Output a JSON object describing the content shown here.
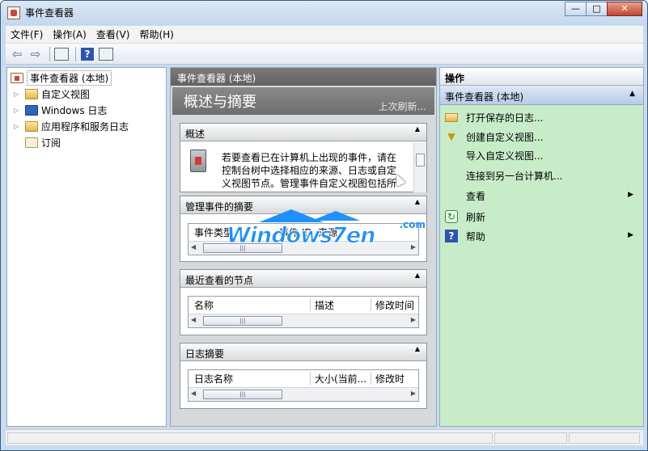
{
  "window": {
    "title": "事件查看器",
    "min": "—",
    "max": "□",
    "close": "✕"
  },
  "menu": [
    "文件(F)",
    "操作(A)",
    "查看(V)",
    "帮助(H)"
  ],
  "tree": [
    {
      "label": "事件查看器 (本地)",
      "icon": "event-viewer-icon",
      "selected": true
    },
    {
      "label": "自定义视图",
      "icon": "folder-icon"
    },
    {
      "label": "Windows 日志",
      "icon": "windows-logs-icon"
    },
    {
      "label": "应用程序和服务日志",
      "icon": "folder-icon"
    },
    {
      "label": "订阅",
      "icon": "subscriptions-icon"
    }
  ],
  "center": {
    "header": "事件查看器 (本地)",
    "banner_title": "概述与摘要",
    "banner_link": "上次刷新...",
    "overview": {
      "title": "概述",
      "text": "若要查看已在计算机上出现的事件，请在控制台树中选择相应的来源、日志或自定义视图节点。管理事件自定义视图包括所"
    },
    "admin_events": {
      "title": "管理事件的摘要",
      "cols": [
        "事件类型",
        "事件 ID",
        "来源"
      ]
    },
    "recent_nodes": {
      "title": "最近查看的节点",
      "cols": [
        "名称",
        "描述",
        "修改时间"
      ]
    },
    "log_summary": {
      "title": "日志摘要",
      "cols": [
        "日志名称",
        "大小(当前...",
        "修改时"
      ]
    }
  },
  "actions": {
    "header": "操作",
    "section": "事件查看器 (本地)",
    "items": [
      {
        "label": "打开保存的日志...",
        "icon": "open-log-icon"
      },
      {
        "label": "创建自定义视图...",
        "icon": "filter-icon"
      },
      {
        "label": "导入自定义视图...",
        "icon": ""
      },
      {
        "label": "连接到另一台计算机...",
        "icon": ""
      },
      {
        "label": "查看",
        "icon": "",
        "submenu": true
      },
      {
        "label": "刷新",
        "icon": "refresh-icon"
      },
      {
        "label": "帮助",
        "icon": "help-icon",
        "submenu": true
      }
    ]
  },
  "watermark": {
    "text": "Windows7en",
    "suffix": ".com"
  }
}
